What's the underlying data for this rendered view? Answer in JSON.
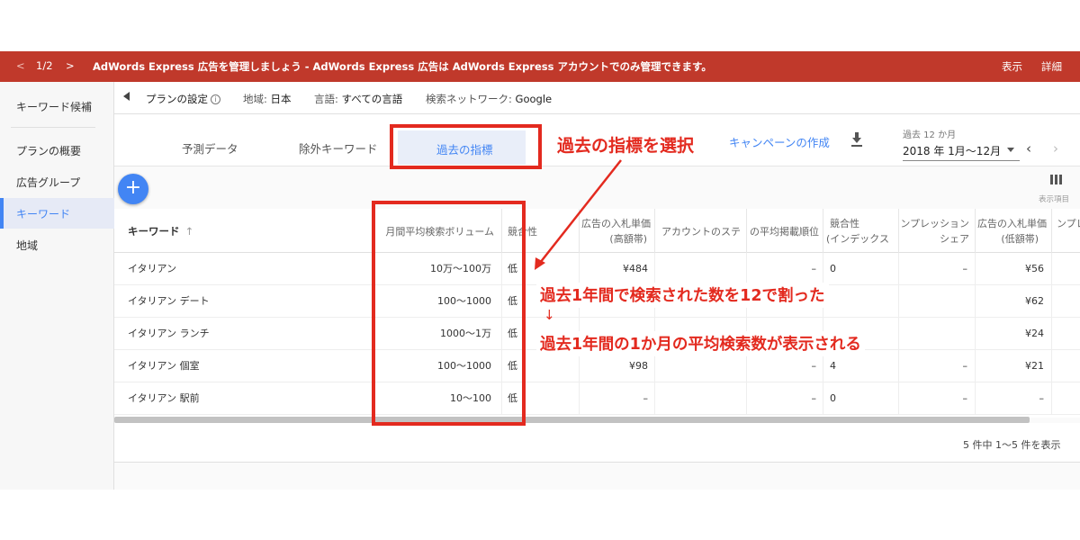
{
  "notice": {
    "prev": "<",
    "page": "1/2",
    "next": ">",
    "message": "AdWords Express 広告を管理しましょう - AdWords Express 広告は AdWords Express アカウントでのみ管理できます。",
    "action_view": "表示",
    "action_details": "詳細",
    "color": "#c0392b"
  },
  "sidebar": {
    "items": [
      "キーワード候補",
      "プランの概要",
      "広告グループ",
      "キーワード",
      "地域"
    ],
    "active_index": 3,
    "accent": "#4285f4"
  },
  "settings": {
    "plan_label": "プランの設定",
    "location_label": "地域:",
    "location_value": "日本",
    "language_label": "言語:",
    "language_value": "すべての言語",
    "network_label": "検索ネットワーク:",
    "network_value": "Google"
  },
  "tabs": {
    "forecast": "予測データ",
    "negative": "除外キーワード",
    "historical": "過去の指標",
    "active": "historical"
  },
  "toolbar": {
    "create_campaign": "キャンペーンの作成",
    "download_icon": "download-icon",
    "period_label": "過去 12 か月",
    "period_value": "2018 年 1月～12月",
    "prev": "‹",
    "next": "›",
    "add_icon": "add-icon",
    "columns_label": "表示項目"
  },
  "table": {
    "headers": {
      "keyword": "キーワード",
      "keyword_sort": "↑",
      "volume": "月間平均検索ボリューム",
      "competition": "競合性",
      "top_bid_high_1": "広告の入札単価",
      "top_bid_high_2": "(高額帯)",
      "account_status": "アカウントのステ",
      "avg_position": "の平均掲載順位",
      "competition_index_1": "競合性",
      "competition_index_2": "(インデックス",
      "impression_share_1": "ンプレッション",
      "impression_share_2": "シェア",
      "top_bid_low_1": "広告の入札単価",
      "top_bid_low_2": "(低額帯)",
      "next_col": "ンプレ"
    },
    "rows": [
      {
        "keyword": "イタリアン",
        "volume": "10万～100万",
        "competition": "低",
        "bid_high": "¥484",
        "account": "",
        "position": "–",
        "index": "0",
        "share": "–",
        "bid_low": "¥56"
      },
      {
        "keyword": "イタリアン デート",
        "volume": "100～1000",
        "competition": "低",
        "bid_high": "",
        "account": "",
        "position": "",
        "index": "",
        "share": "",
        "bid_low": "¥62"
      },
      {
        "keyword": "イタリアン ランチ",
        "volume": "1000～1万",
        "competition": "低",
        "bid_high": "",
        "account": "",
        "position": "",
        "index": "",
        "share": "",
        "bid_low": "¥24"
      },
      {
        "keyword": "イタリアン 個室",
        "volume": "100～1000",
        "competition": "低",
        "bid_high": "¥98",
        "account": "",
        "position": "–",
        "index": "4",
        "share": "–",
        "bid_low": "¥21"
      },
      {
        "keyword": "イタリアン 駅前",
        "volume": "10～100",
        "competition": "低",
        "bid_high": "–",
        "account": "",
        "position": "–",
        "index": "0",
        "share": "–",
        "bid_low": "–"
      }
    ],
    "footer": "5 件中 1～5 件を表示"
  },
  "annotations": {
    "select_historical": "過去の指標を選択",
    "line1": "過去1年間で検索された数を12で割った",
    "arrow": "↓",
    "line2": "過去1年間の1か月の平均検索数が表示される",
    "color": "#e32a1f"
  }
}
